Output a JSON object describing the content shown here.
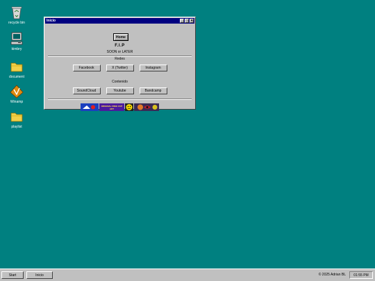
{
  "desktop": {
    "icons": [
      {
        "label": "recycle bin",
        "icon": "recycle-bin-icon"
      },
      {
        "label": "kimbry",
        "icon": "computer-icon"
      },
      {
        "label": "document",
        "icon": "folder-icon"
      },
      {
        "label": "Winamp",
        "icon": "winamp-icon"
      },
      {
        "label": "playlist",
        "icon": "folder-icon"
      }
    ]
  },
  "window": {
    "title": "Inicio",
    "controls": {
      "minimize": "_",
      "maximize": "□",
      "close": "✕"
    },
    "home_label": "Home",
    "logo_text": "F.I.P",
    "tagline": "SOON or LATER",
    "redes_label": "Redes",
    "redes": [
      "Facebook",
      "X (Twitter)",
      "Instagram"
    ],
    "contenido_label": "Contenido",
    "contenido": [
      "SoundCloud",
      "Youtube",
      "Bandcamp"
    ],
    "badges": [
      {
        "text": "",
        "color": "#1b3fbf",
        "icon": "flag-badge"
      },
      {
        "text": "ORIGINAL FREE CUP ART",
        "color": "#4b1b9e",
        "icon": "art-badge"
      },
      {
        "text": "",
        "color": "#222222",
        "icon": "smiley-badge"
      },
      {
        "text": "",
        "color": "#6b2a6b",
        "icon": "eye-badge"
      }
    ]
  },
  "taskbar": {
    "start_label": "Start",
    "task_label": "Inicio",
    "copyright": "© 2025 Adrian BL",
    "clock": "01:55 PM"
  },
  "colors": {
    "desktop": "#008080",
    "titlebar": "#000080",
    "face": "#c0c0c0"
  }
}
